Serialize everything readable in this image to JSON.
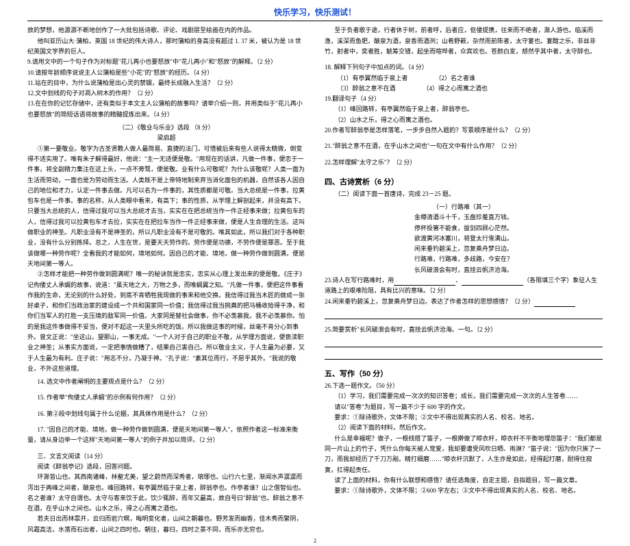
{
  "header": "快乐学习，快乐测试！",
  "left": {
    "p1": "放的梦想，他源源不断地创作了一大批包括诗歌、评论、戏剧层至绘画在内的作品。",
    "p2": "他叫亚历山大·蒲柏，英国 18 世纪的伟大诗人，那时蒲柏的身高没有超过 1. 37 米，被认为是 18 世纪英国文学界的巨人。",
    "q9": "9.请用文中的一个句子作为对标题\"花儿再小也要怒放\"中\"花儿再小\"和\"怒放\"的解释。（2 分）",
    "q10": "10.请按年龄顺序说说主人公蒲柏是些\"小花\"的\"怒放\"的经历。（4 分）",
    "q11": "11.站在的目中，为什么说蒲柏是出心灵的禁锢，最终长成融入生活？（2 分）",
    "q12": "12.文中划线的句子对凋入树木的作用？（2 分）",
    "q13": "13.在在你的记忆存储中，还有类似于本文主人公蒲柏的故事吗？请举介绍一则，并用类似于\"花儿再小也要怒放\"的简短话语将故事的精髓提炼出来。（4 分）",
    "subhead1": "（二）《敬业与乐业》选段    （8 分）",
    "author1": "梁启超",
    "p_para1": "①第一要敬业。敬字为古圣贤教人做人最简易、直捷的法门，可惜被后来有些人说得太精微，倒变得不适实用了。唯有朱子解得最好，他说：\"主一无适便是敬。\"用现在的话讲，凡做一件事，便忠于一件事，将全副精力集注在这上头，一点不旁骛，便是敬。业有什么可敬呢？为什么该敬呢？人类一面为生活而劳动，一面也是为劳动而生活。人类既不是上帝特地制来弃当消化面包的机器，自然该各人因自己的地位和才力，认定一件事去做。凡可以名为一件事的，其性质都是可敬。当大总统是一件事，拉黄包车也是一件事。事的名称，从人类眼中看来，有高下；事的性质，从学理上解剖起来，并没有高下。只要当大总统的人，信得过我可以当大总统才去当，实实在在把总统当作一件正经事来做；拉黄包车的人，信得过我可以拉黄包车才去拉，实实在在把拉车当作一件正经事来做，便是人生合理的生活。这叫做职业的神圣。凡职业没有不是神圣的，所以凡职业没有不是可敬的。唯其如此，所以我们对于各种职业，没有什么分别拣择。总之，人生在世，是要天天劳作的。劳作便是功德，不劳作便是罪恶。至于我该做哪一种劳作呢？全看我的才能如何，境地如何。因自己的才能、境地，做一种劳作做到圆满，便是天地间第一等人。",
    "p_para2": "②怎样才能把一种劳作做到圆满呢？唯一的秘诀就是忠实，忠实从心理上发出来的便是敬。《庄子》记佝偻丈人承蜩的故事，说道：\"虽天地之大，万物之多，而唯蜩翼之知。\"凡做一件事，便把这件事看作我的生命，无论别的什么好处，到底不肯牺牲我现做的事来和他交换。我信得过我当木匠的做成一张好桌子，和你们当政治家的建设成一个共和国家同一价值；我信得过我当挑粪的把马桶收拾得干净，和你们当军人的打胜一支压境的敌军同一价值。大家同是替社会做事，你不必羡慕我，我不必羡慕你。怕的是我这件事做得不妥当，便对不起这一天里头所吃的饭。所以我做这事的时候，丝毫不肯分心到事外。曾文正说：\"坐这山，望那山，一事无成。\"一个人对于自己的职业不敬，从学理方面说，便亵渎职业之神圣；从事实方面说，一定把事情做糟了，结果自己害自己。所以敬业主义，于人生最为必要，又于人生最为有利。庄子说：\"用志不分，乃凝于神。\"孔子说：\"素其位而行，不愿乎其外。\"我说的敬业，不外这些道理。",
    "q14": "14. 选文中作者阐明的主要观点是什么？（2 分）",
    "q15": "15. 作者举\"佝偻丈人承蜩\"的示例有何作用？（2 分）",
    "q16": "16. 第②段中划线句属于什么论据，其具体作用是什么？（2 分）",
    "q17": "17. \"因自己的才能、境地，做一种劳作做到圆满，便是天地间第一等人\"，依照作者这一标准来衡量，请从身边举一个这样\"天地间第一等人\"的例子并加以简评。（2 分）",
    "subhead2": "三、文言文阅读（14 分）",
    "instr2": "阅读《醉翁亭记》选段，回答问题。",
    "wenyan1": "环滁皆山也。其西南诸峰，林壑尤美，望之蔚然而深秀者，琅琊也。山行六七里，渐闻水声潺潺而泻出于两峰之间者，酿泉也。峰回路转，有亭翼然临于泉上者，醉翁亭也。作亭者谁？山之僧智仙也。名之者谁？太守自谓也。太守与客来饮于此，饮少辄醉，而年又最高，故自号曰\"醉翁\"也。醉翁之意不在酒，在乎山水之间也。山水之乐，得之心而寓之酒也。",
    "wenyan2": "若夫日出而林霏开，云归而岩穴暝，晦明变化者，山间之朝暮也。野芳发而幽香，佳木秀而繁阴，风霜高洁，水落而石出者，山间之四时也。朝往，暮归，四时之景不同，而乐亦无穷也。"
  },
  "right": {
    "wenyan3": "至于负者歌于途，行者休于树，前者呼，后者应，伛偻提携，往来而不绝者，滁人游也。临溪而渔，溪深而鱼肥，酿泉为酒，泉香而酒洌；山肴野蔌，杂然而前陈者，太守宴也。宴酣之乐，非丝非竹，射者中，奕者胜，觥筹交错，起坐而喧哗者，众宾欢也。苍颜白发，颓然乎其中者，太守醉也。",
    "q18": "18. 解释下列句子中加点的词。（4 分）",
    "q18a": "（1）有亭翼然临于泉上者",
    "q18b": "（2）名之者谁",
    "q18c": "（3）醉翁之意不在酒",
    "q18d": "（4）得之心而寓之酒也",
    "q19": "19.翻译句子（4 分）",
    "q19a": "（1）峰回路转，有亭翼然临于泉上者，醉翁亭也。",
    "q19b": "（2）山水之乐，得之心而寓之酒也。",
    "q20": "20.作者写醉翁亭是怎样落笔，一步步自然入题的？写景顺序是什么？（2 分）",
    "q21": "21.\"醉翁之意不在酒，在乎山水之间也\"一句在文中有什么作用？（2 分）",
    "q22": "22.怎样理解\"太守之乐\"？（2 分）",
    "sect4_title": "四、古诗赏析（6 分）",
    "sect4_instr": "（二）阅读下面一首唐诗，完成 23－25 题。",
    "poem_title": "（一）行路难（其一）",
    "poem_l1": "金樽清酒斗十千，玉盘珍羞直万钱。",
    "poem_l2": "停杯投箸不能食，拔剑四顾心茫然。",
    "poem_l3": "欲渡黄河冰塞川，将登太行雪满山。",
    "poem_l4": "闲来垂钓碧溪上，忽复乘舟梦日边。",
    "poem_l5": "行路难，行路难，多歧路，今安在？",
    "poem_l6": "长风破浪会有时，直挂云帆济沧海。",
    "q23a": "23.诗人在写行路难时，用",
    "q23b": "、",
    "q23c": "（各限填三个字）象征人生道路上的艰难险阻，具有比兴的意味。（2 分）",
    "q24a": "24.闲来垂钓碧溪上，忽复乘舟梦日边。表达了作者怎样的思想感情？（2 分）",
    "q25": "25.简要赏析\"长风破浪会有时，直挂云帆济沧海。一句。（2 分）",
    "sect5_title": "五、写作（50 分）",
    "q26": "26.下选一题作文。（50 分）",
    "w1": "（1）学习，我们需要完成一次次的知识答卷；成长，我们需要完成一次次的人生答卷……",
    "w2": "请以\"答卷\"为题目，写一篇不少于 600 字的作文。",
    "w3": "要求：①除诗歌外，文体不限；②文中不得出现真实的人名、校名、地名。",
    "w4": "（2）阅读下面的材料，然后作文。",
    "w5": "什么是幸福呢？做子，一根线搭了笛子，一根擀做了晾衣杆，晾衣杆不平衡地埋怨笛子：\"我们都是同一片山上的竹子，凭什么你每天被人宠爱，我却要遭受风吹日晒、雨淋？\"笛子说：\"因为你只挨了一刀，而我却经历了千刀万剐。精打细磨……\"晾衣杆沉默了，人生亦是如此，经得起打磨，耐得住寂寞，扛得起责任。",
    "w6": "读了上面的材料，你有什么联想和感悟？请任选角度，自定主题，自拟题目，写一篇文章。",
    "w7": "要求：①除诗歌外，文体不限；②600 字左右；③文中不得出现真实的人名、校名、地名。"
  },
  "page_num": "2"
}
